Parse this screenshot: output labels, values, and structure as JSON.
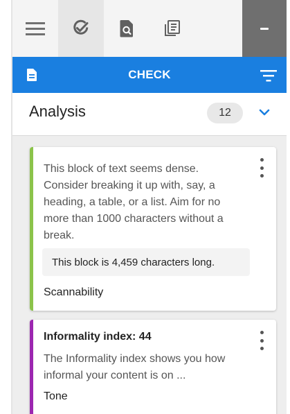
{
  "toolbar": {
    "items": [
      {
        "icon": "menu-icon",
        "active": false
      },
      {
        "icon": "check-review-icon",
        "active": true
      },
      {
        "icon": "search-document-icon",
        "active": false
      },
      {
        "icon": "notes-document-icon",
        "active": false
      }
    ],
    "minimize_icon": "minus-icon"
  },
  "check_bar": {
    "title": "CHECK",
    "left_icon": "document-icon",
    "right_icon": "filter-icon",
    "color": "#1a7fe0"
  },
  "analysis": {
    "label": "Analysis",
    "count": "12",
    "toggle_icon": "chevron-down-icon"
  },
  "cards": [
    {
      "body": "This block of text seems dense. Consider breaking it up with, say, a heading, a table, or a list. Aim for no more than 1000 characters without a break.",
      "meta": "This block is 4,459 characters long.",
      "category": "Scannability",
      "accent": "#8bc34a"
    },
    {
      "heading": "Informality index: 44",
      "body": "The Informality index shows you how informal your content is on ...",
      "category": "Tone",
      "accent": "#9c27b0"
    }
  ]
}
